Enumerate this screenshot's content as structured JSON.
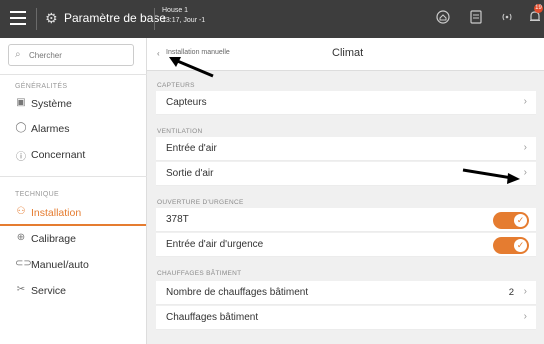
{
  "header": {
    "title": "Paramètre de base",
    "house_name": "House 1",
    "house_time": "13:17, Jour -1",
    "notification_count": "19",
    "icons": [
      "menu-icon",
      "gear-icon",
      "house-icon",
      "document-icon",
      "signal-icon",
      "bell-icon"
    ]
  },
  "sidebar": {
    "search_placeholder": "Chercher",
    "sections": [
      {
        "label": "GÉNÉRALITÉS",
        "items": [
          {
            "label": "Système",
            "icon": "monitor-icon"
          },
          {
            "label": "Alarmes",
            "icon": "alarm-icon"
          },
          {
            "label": "Concernant",
            "icon": "info-icon"
          }
        ]
      },
      {
        "label": "TECHNIQUE",
        "items": [
          {
            "label": "Installation",
            "icon": "installation-icon",
            "active": true
          },
          {
            "label": "Calibrage",
            "icon": "calibration-icon"
          },
          {
            "label": "Manuel/auto",
            "icon": "toggle-icon"
          },
          {
            "label": "Service",
            "icon": "tools-icon"
          }
        ]
      }
    ],
    "accent_color": "#e57c30"
  },
  "main": {
    "breadcrumb": "Installation manuelle",
    "page_title": "Climat",
    "groups": [
      {
        "label": "CAPTEURS",
        "rows": [
          {
            "label": "Capteurs"
          }
        ]
      },
      {
        "label": "VENTILATION",
        "rows": [
          {
            "label": "Entrée d'air"
          },
          {
            "label": "Sortie d'air"
          }
        ]
      },
      {
        "label": "OUVERTURE D'URGENCE",
        "rows": [
          {
            "label": "378T",
            "toggle": "on"
          },
          {
            "label": "Entrée d'air d'urgence",
            "toggle": "on"
          }
        ]
      },
      {
        "label": "CHAUFFAGES BÂTIMENT",
        "rows": [
          {
            "label": "Nombre de chauffages bâtiment",
            "value": "2"
          },
          {
            "label": "Chauffages bâtiment"
          }
        ]
      }
    ]
  }
}
